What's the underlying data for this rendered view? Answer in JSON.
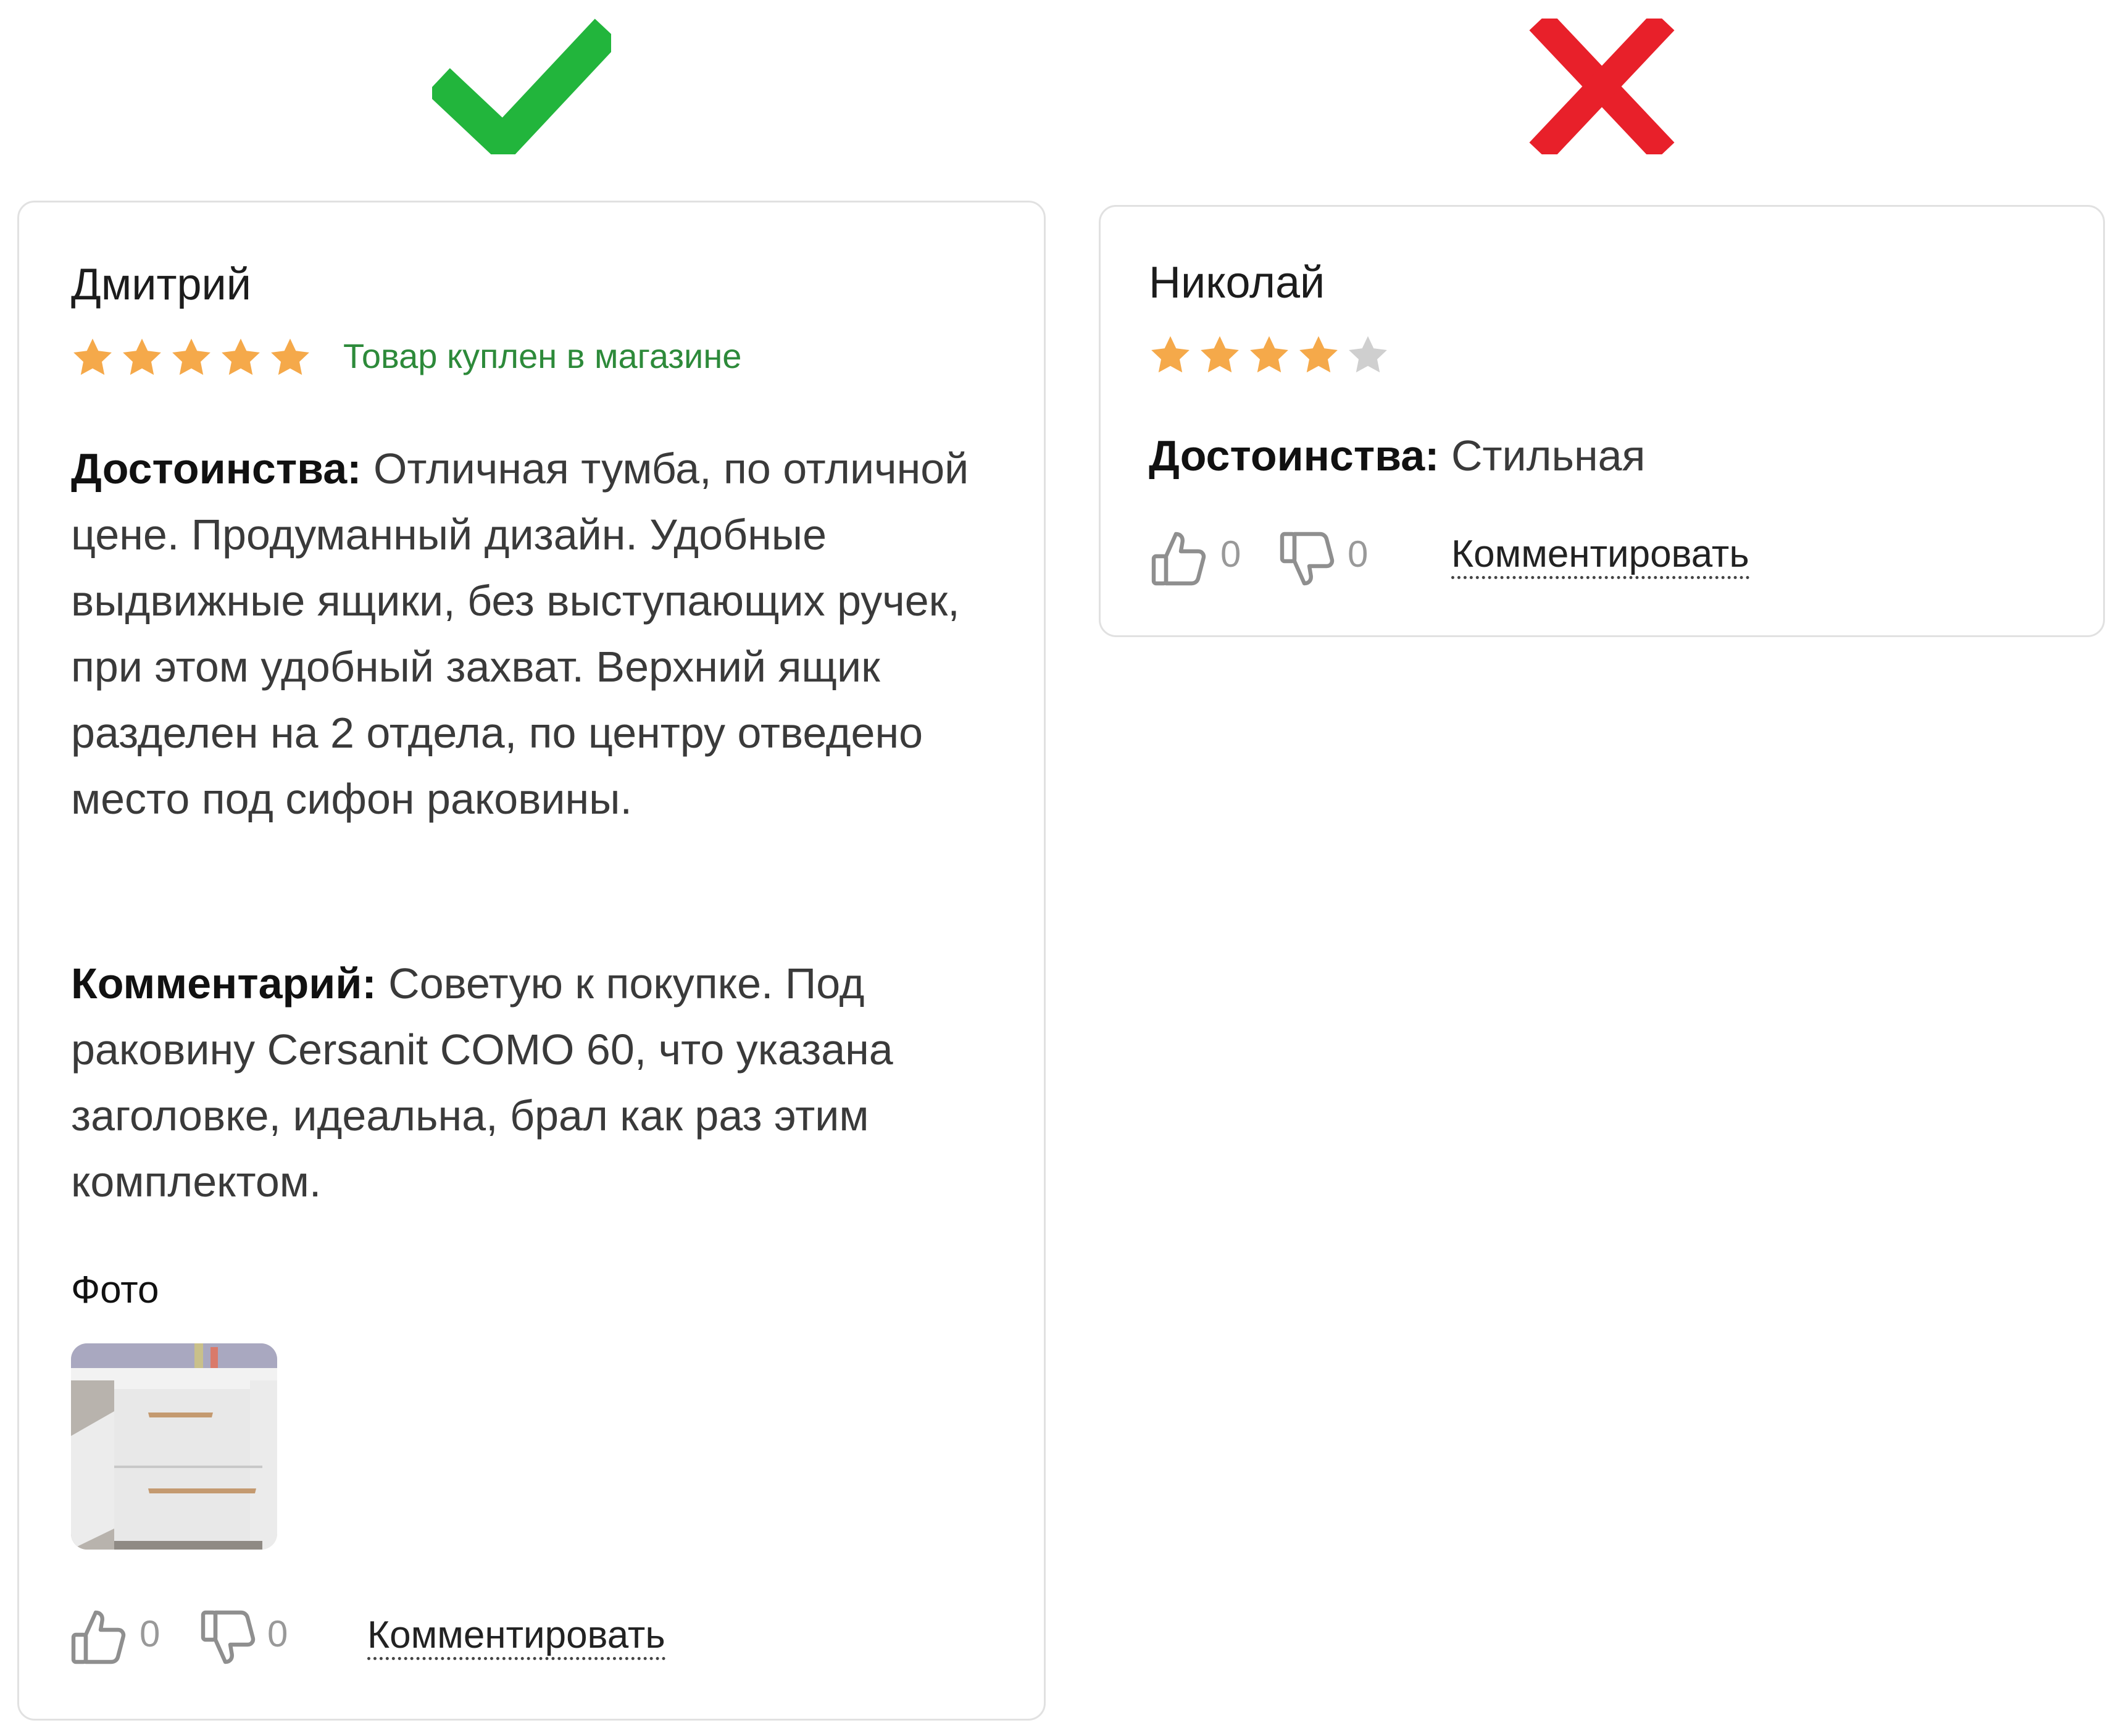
{
  "good_review": {
    "author": "Дмитрий",
    "rating": 5,
    "verified_label": "Товар куплен в магазине",
    "pros_label": "Достоинства:",
    "pros_text": "Отличная тумба, по отличной цене. Продуманный дизайн. Удобные выдвижные ящики, без выступающих ручек, при этом удобный захват. Верхний ящик разделен на 2 отдела, по центру отведено место под сифон раковины.",
    "comment_label": "Комментарий:",
    "comment_text": "Советую к покупке. Под раковину Cersanit COMO 60, что указана заголовке, идеальна, брал как раз этим комплектом.",
    "photo_title": "Фото",
    "likes": "0",
    "dislikes": "0",
    "comment_action": "Комментировать"
  },
  "bad_review": {
    "author": "Николай",
    "rating": 4,
    "pros_label": "Достоинства:",
    "pros_text": "Стильная",
    "likes": "0",
    "dislikes": "0",
    "comment_action": "Комментировать"
  },
  "colors": {
    "check": "#22b53c",
    "cross": "#e8202a",
    "star_filled": "#f5a94a",
    "star_empty": "#cfcfcf",
    "verified": "#2d8a3a"
  },
  "icons": [
    "check-icon",
    "cross-icon",
    "star-icon",
    "thumbs-up-icon",
    "thumbs-down-icon"
  ]
}
